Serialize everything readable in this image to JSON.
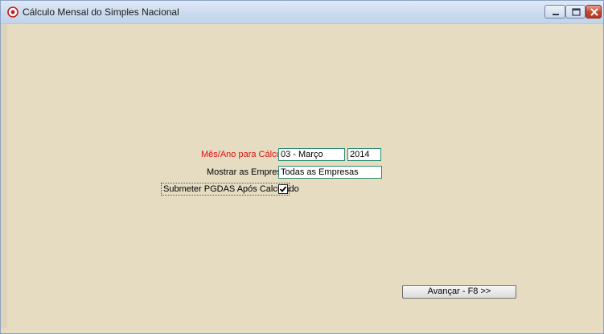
{
  "window": {
    "title": "Cálculo Mensal do Simples Nacional"
  },
  "form": {
    "period_label": "Mês/Ano para Cálculo",
    "month_value": "03 - Março",
    "year_value": "2014",
    "companies_label": "Mostrar as Empresas",
    "companies_value": "Todas as Empresas",
    "submit_pgdas_label": "Submeter PGDAS Após Calculado",
    "submit_pgdas_checked": true
  },
  "actions": {
    "next_button_label": "Avançar - F8 >>"
  },
  "colors": {
    "background": "#e5dcc2",
    "required_label": "#e01010",
    "field_border": "#2d8c6e",
    "titlebar": "#c9d9ee"
  },
  "icons": {
    "app": "radio-target-icon",
    "minimize": "minimize-icon",
    "maximize": "maximize-icon",
    "close": "close-icon",
    "check": "checkmark-icon"
  }
}
